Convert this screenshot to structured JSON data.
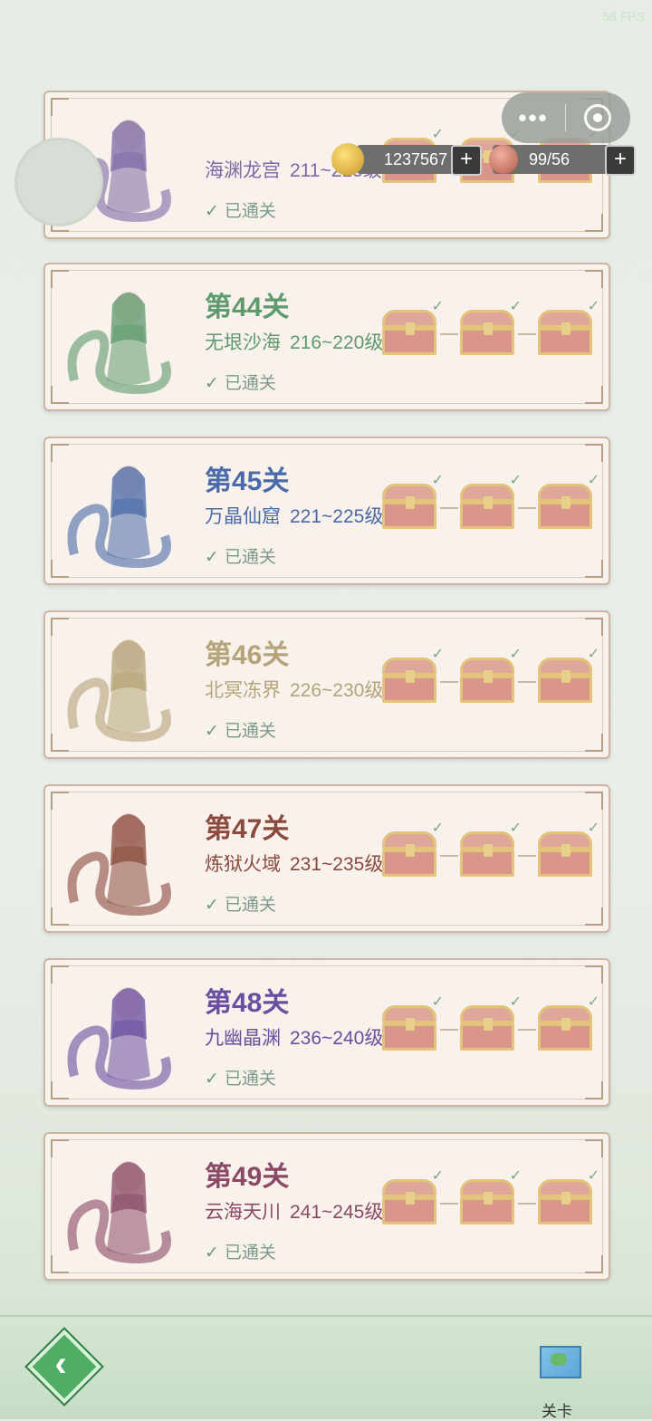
{
  "fps": "58 FPS",
  "resources": {
    "gold": "1237567",
    "gems": "99/56"
  },
  "levels": [
    {
      "title": "",
      "zone": "海渊龙宫",
      "range": "211~215级",
      "cleared": "已通关",
      "color": "#7b6aa6",
      "partial": true
    },
    {
      "title": "第44关",
      "zone": "无垠沙海",
      "range": "216~220级",
      "cleared": "已通关",
      "color": "#5f9a6e"
    },
    {
      "title": "第45关",
      "zone": "万晶仙窟",
      "range": "221~225级",
      "cleared": "已通关",
      "color": "#4a6aa8"
    },
    {
      "title": "第46关",
      "zone": "北冥冻界",
      "range": "226~230级",
      "cleared": "已通关",
      "color": "#b4a479"
    },
    {
      "title": "第47关",
      "zone": "炼狱火域",
      "range": "231~235级",
      "cleared": "已通关",
      "color": "#8a4a3e"
    },
    {
      "title": "第48关",
      "zone": "九幽晶渊",
      "range": "236~240级",
      "cleared": "已通关",
      "color": "#6a4ea0"
    },
    {
      "title": "第49关",
      "zone": "云海天川",
      "range": "241~245级",
      "cleared": "已通关",
      "color": "#8a4a66"
    }
  ],
  "bottom": {
    "nav_label": "关卡"
  },
  "icons": {
    "back": "back-arrow-icon",
    "map": "map-icon"
  }
}
